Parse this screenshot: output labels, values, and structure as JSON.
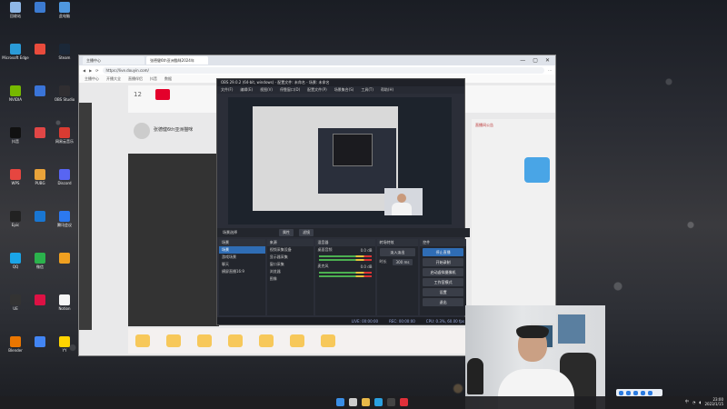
{
  "desktop": {
    "icons": [
      {
        "label": "回收站",
        "color": "#8fb7e6"
      },
      {
        "label": "",
        "color": "#3c7bd1"
      },
      {
        "label": "此电脑",
        "color": "#4f98e0"
      },
      {
        "label": "Microsoft Edge",
        "color": "#2a9bd8"
      },
      {
        "label": "",
        "color": "#e94b3c"
      },
      {
        "label": "Steam",
        "color": "#1b2838"
      },
      {
        "label": "NVIDIA",
        "color": "#76b900"
      },
      {
        "label": "",
        "color": "#3a74d8"
      },
      {
        "label": "OBS Studio",
        "color": "#302e31"
      },
      {
        "label": "抖音",
        "color": "#111"
      },
      {
        "label": "",
        "color": "#e04646"
      },
      {
        "label": "网易云音乐",
        "color": "#d93b32"
      },
      {
        "label": "WPS",
        "color": "#e64640"
      },
      {
        "label": "PUBG",
        "color": "#e9a33a"
      },
      {
        "label": "Discord",
        "color": "#5865f2"
      },
      {
        "label": "Epic",
        "color": "#222"
      },
      {
        "label": "",
        "color": "#1976d2"
      },
      {
        "label": "腾讯会议",
        "color": "#2c79f0"
      },
      {
        "label": "QQ",
        "color": "#1aa5e8"
      },
      {
        "label": "微信",
        "color": "#2bb24c"
      },
      {
        "label": "",
        "color": "#f0a020"
      },
      {
        "label": "UE",
        "color": "#333"
      },
      {
        "label": "",
        "color": "#d14"
      },
      {
        "label": "Notion",
        "color": "#f5f5f5"
      },
      {
        "label": "Blender",
        "color": "#ea7600"
      },
      {
        "label": "",
        "color": "#4285f4"
      },
      {
        "label": "YY",
        "color": "#ffd400"
      }
    ]
  },
  "browser": {
    "tabs": [
      {
        "label": "主播中心",
        "active": false
      },
      {
        "label": "张德健6th亚洲猫咪2024年",
        "active": true
      }
    ],
    "controls": {
      "minimize": "—",
      "maximize": "▢",
      "close": "✕"
    },
    "url": "https://live.douyin.com/",
    "bookmarks": [
      "主播中心",
      "开播大全",
      "直播伴侣",
      "抖音",
      "数据"
    ],
    "douyin": {
      "follow_count": "12",
      "title": "张德健6th亚洲猫咪",
      "side_text": "直播间公告"
    }
  },
  "obs": {
    "title": "OBS 29.0.2 (64-bit, windows) - 配置文件: 未命名 - 场景: 未命名",
    "menu": [
      "文件(F)",
      "编辑(E)",
      "视图(V)",
      "停靠窗口(D)",
      "配置文件(P)",
      "场景集合(S)",
      "工具(T)",
      "帮助(H)"
    ],
    "strip": {
      "label": "场景选择",
      "button1": "属性",
      "button2": "滤镜"
    },
    "scenes": {
      "header": "场景",
      "items": [
        "场景",
        "游戏场景",
        "聊天",
        "横屏直播16:9"
      ]
    },
    "sources": {
      "header": "来源",
      "items": [
        "视频采集设备",
        "显示器采集",
        "窗口采集",
        "浏览器",
        "图像"
      ]
    },
    "mixer": {
      "header": "混音器",
      "items": [
        {
          "name": "桌面音频",
          "level": "0.0 dB"
        },
        {
          "name": "麦克风",
          "level": "0.0 dB"
        }
      ]
    },
    "transitions": {
      "header": "转场特效",
      "type": "淡入淡出",
      "duration_label": "时长",
      "duration": "300 ms"
    },
    "controls": {
      "header": "控件",
      "buttons": [
        "停止直播",
        "开始录制",
        "启动虚拟摄像机",
        "工作室模式",
        "设置",
        "退出"
      ]
    },
    "status": {
      "live": "LIVE: 00:00:00",
      "rec": "REC: 00:00:00",
      "cpu": "CPU: 0.3%, 60.00 fps"
    }
  },
  "taskbar": {
    "time": "23:00",
    "date": "2023/1/15",
    "lang": "中"
  }
}
